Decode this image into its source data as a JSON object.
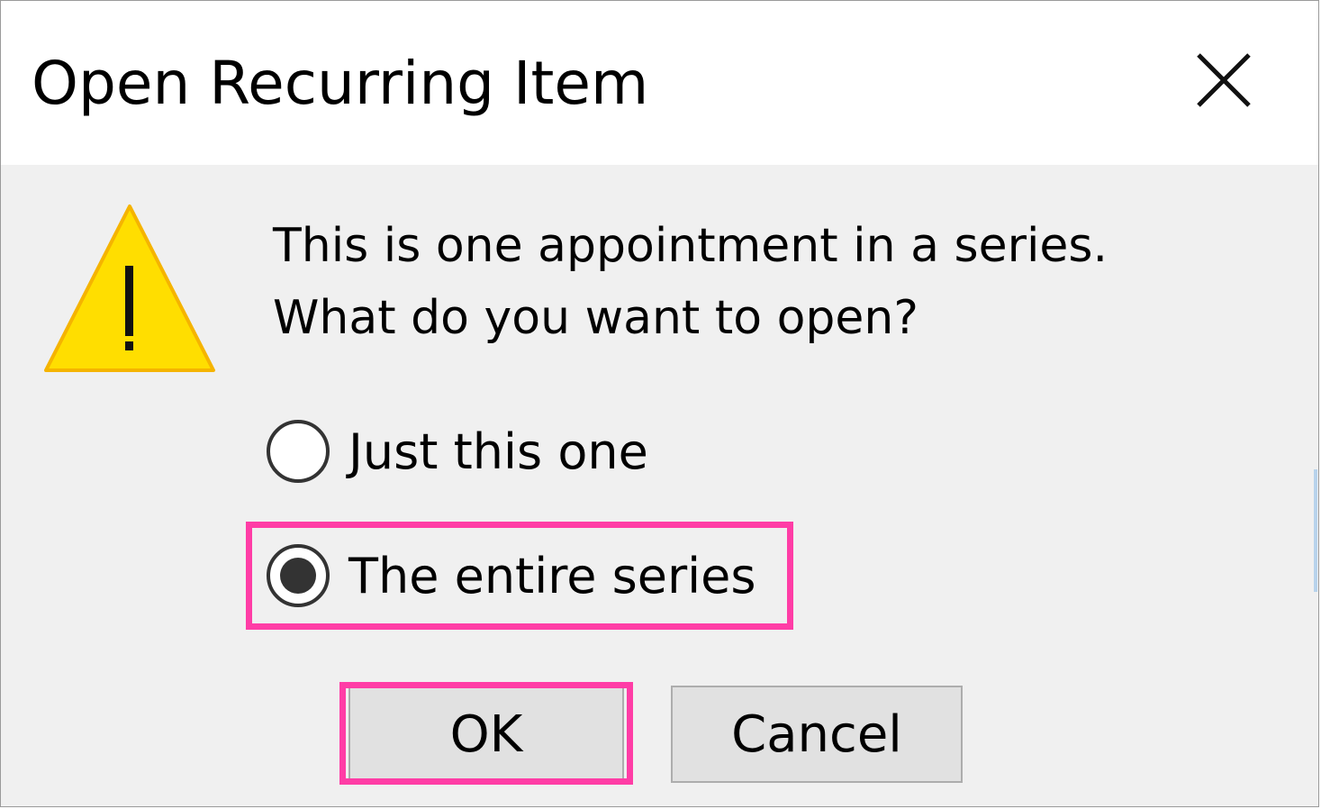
{
  "dialog": {
    "title": "Open Recurring Item",
    "close_icon": "close-icon",
    "warning_icon": "warning-triangle-icon",
    "message_line1": "This is one appointment in a series.",
    "message_line2": "What do you want to open?"
  },
  "options": [
    {
      "label": "Just this one",
      "selected": false
    },
    {
      "label": "The entire series",
      "selected": true
    }
  ],
  "buttons": {
    "ok_label": "OK",
    "cancel_label": "Cancel"
  },
  "colors": {
    "highlight": "#ff3da6",
    "warning_fill": "#ffde00",
    "warning_stroke": "#f5b400",
    "dialog_bg": "#f0f0f0"
  }
}
